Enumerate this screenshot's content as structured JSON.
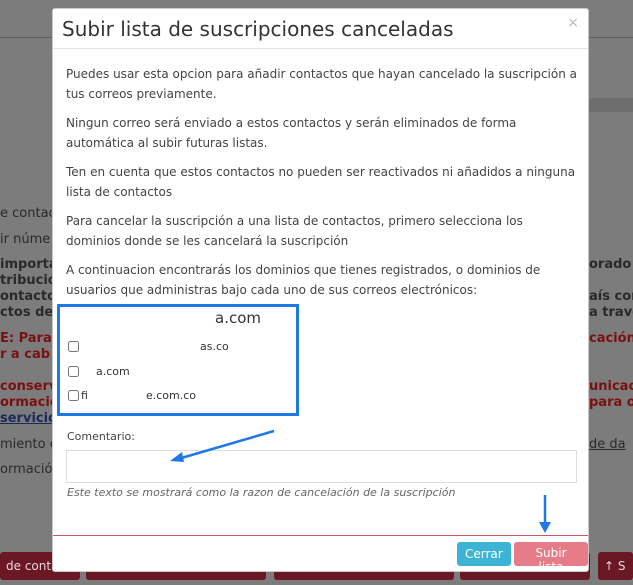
{
  "background": {
    "lines": [
      "e contac",
      "ir núme",
      "importa",
      "tribució",
      "ontactos",
      "ctos deb",
      "E: Para",
      "r a cab",
      "conserv",
      "ormació",
      " servicio",
      "miento c",
      "ormació"
    ],
    "right_lines": [
      "orado t",
      "aís corr",
      "a travé",
      "cación,",
      "unicac",
      "para o",
      "de da"
    ],
    "buttons": [
      "de contac",
      "",
      "",
      "",
      "",
      "↑ S"
    ]
  },
  "modal": {
    "title": "Subir lista de suscripciones canceladas",
    "close": "×",
    "paragraphs": [
      "Puedes usar esta opcion para añadir contactos que hayan cancelado la suscripción a tus correos previamente.",
      "Ningun correo será enviado a estos contactos y serán eliminados de forma automática al subir futuras listas.",
      "Ten en cuenta que estos contactos no pueden ser reactivados ni añadidos a ninguna lista de contactos",
      "Para cancelar la suscripción a una lista de contactos, primero selecciona los dominios donde se les cancelará la suscripción",
      "A continuacion encontrarás los dominios que tienes registrados, o dominios de usuarios que administras bajo cada uno de sus correos electrónicos:"
    ],
    "domains": {
      "main": "a.com",
      "items": [
        "as.co",
        "a.com",
        "e.com.co"
      ],
      "prefix_item3": "fi"
    },
    "comment": {
      "label": "Comentario:",
      "value": "",
      "help": "Este texto se mostrará como la razon de cancelación de la suscripción"
    },
    "buttons": {
      "cancel": "Cerrar",
      "submit": "Subir lista"
    }
  },
  "colors": {
    "highlight": "#1f78e8",
    "cancel": "#3db4d6",
    "submit": "#e57c88"
  }
}
